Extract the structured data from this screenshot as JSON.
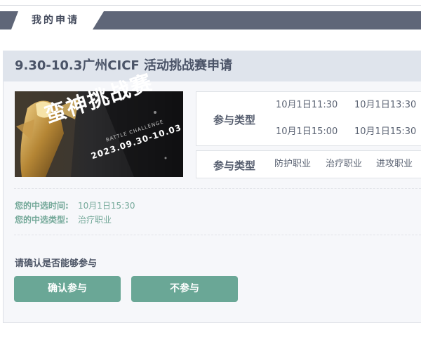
{
  "header": {
    "tab_label": "我的申请"
  },
  "event": {
    "title": "9.30-10.3广州CICF 活动挑战赛申请",
    "banner": {
      "title": "蛮神挑战赛",
      "subtitle": "BATTLE CHALLENGE",
      "dates": "2023.09.30-10.03"
    }
  },
  "time_panel": {
    "label": "参与类型",
    "options": [
      "10月1日11:30",
      "10月1日13:30",
      "10月1日15:00",
      "10月1日15:30"
    ]
  },
  "role_panel": {
    "label": "参与类型",
    "options": [
      "防护职业",
      "治疗职业",
      "进攻职业"
    ]
  },
  "selection": {
    "time_label": "您的中选时间:",
    "time_value": "10月1日15:30",
    "type_label": "您的中选类型:",
    "type_value": "治疗职业"
  },
  "confirm": {
    "prompt": "请确认是否能够参与",
    "accept_label": "确认参与",
    "decline_label": "不参与"
  },
  "colors": {
    "header": "#5f6678",
    "accent_green": "#6aa796",
    "title_bar": "#dfe4ec"
  }
}
